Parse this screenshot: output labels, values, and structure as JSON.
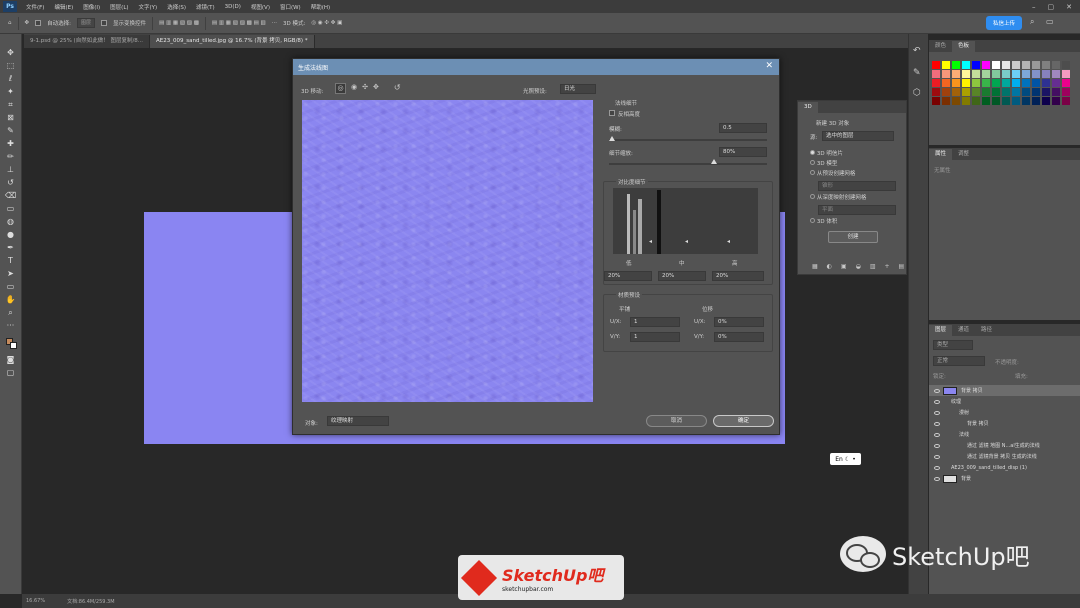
{
  "menu": {
    "items": [
      "文件(F)",
      "编辑(E)",
      "图像(I)",
      "图层(L)",
      "文字(Y)",
      "选择(S)",
      "滤镜(T)",
      "3D(D)",
      "视图(V)",
      "窗口(W)",
      "帮助(H)"
    ],
    "app_badge": "Ps"
  },
  "options": {
    "auto_select": "自动选择:",
    "auto_select_value": "图层",
    "show_transform": "显示变换控件",
    "mode_3d": "3D 模式:",
    "cloud_button": "私信上传"
  },
  "tabs": [
    {
      "label": "9-1.psd @ 25% (自然如此做！ 图层复制/8...",
      "active": false
    },
    {
      "label": "AE23_009_sand_tilled.jpg @ 16.7% (背景 拷贝, RGB/8) *",
      "active": true
    }
  ],
  "status": {
    "zoom": "16.67%",
    "doc": "文档:86.4M/259.3M"
  },
  "dialog": {
    "title": "生成法线图",
    "move_3d": "3D 移动:",
    "light_preset_label": "光照预设:",
    "light_preset_value": "日光",
    "fine_detail": {
      "title": "法线细节",
      "invert_height": "反相高度",
      "blur_label": "模糊:",
      "blur_value": "0.5",
      "detail_label": "细节缩放:",
      "detail_value": "80%"
    },
    "contrast": {
      "title": "对比度细节",
      "low": "低",
      "mid": "中",
      "high": "高",
      "low_val": "20%",
      "mid_val": "20%",
      "high_val": "20%"
    },
    "material": {
      "title": "材质预设",
      "tiling": "平铺",
      "offset": "位移",
      "ux": "U/X:",
      "vy": "V/Y:",
      "tile_u": "1",
      "tile_v": "1",
      "off_u": "0%",
      "off_v": "0%"
    },
    "object_label": "对象:",
    "object_value": "纹理映射",
    "cancel": "取消",
    "ok": "确定"
  },
  "panel3d": {
    "tab": "3D",
    "new_object": "新建 3D 对象",
    "source_label": "源:",
    "source_value": "选中的图层",
    "options": [
      "3D 明信片",
      "3D 模型",
      "从预设创建网格",
      "从深度映射创建网格",
      "3D 体积"
    ],
    "preset_hint": "锥形",
    "depth_hint": "平面",
    "create": "创建"
  },
  "swatches": {
    "tabs": [
      "颜色",
      "色板"
    ],
    "colors": [
      "#ff0000",
      "#ffff00",
      "#00ff00",
      "#00ffff",
      "#0000ff",
      "#ff00ff",
      "#ffffff",
      "#e6e6e6",
      "#cccccc",
      "#b3b3b3",
      "#999999",
      "#808080",
      "#666666",
      "#4d4d4d",
      "#f26d7d",
      "#f7977a",
      "#fbad76",
      "#fff79a",
      "#c4df9b",
      "#a3d39c",
      "#82ca9c",
      "#7accc8",
      "#6dcff6",
      "#7da7d9",
      "#8393ca",
      "#8781bd",
      "#a187be",
      "#f49ac1",
      "#ed1c24",
      "#f26522",
      "#f7941d",
      "#fff200",
      "#8dc63f",
      "#39b54a",
      "#00a651",
      "#00a99d",
      "#00aeef",
      "#0072bc",
      "#0054a6",
      "#2e3192",
      "#662d91",
      "#ec008c",
      "#9e0b0f",
      "#a0410d",
      "#a36209",
      "#aba000",
      "#598527",
      "#1a7b30",
      "#007236",
      "#00746b",
      "#0076a3",
      "#004b80",
      "#003471",
      "#1b1464",
      "#440e62",
      "#9e005d",
      "#790000",
      "#7b2e00",
      "#7d4900",
      "#827b00",
      "#406618",
      "#005e20",
      "#005826",
      "#005952",
      "#005b7f",
      "#003663",
      "#002157",
      "#0d004c",
      "#32004b",
      "#7b0046"
    ]
  },
  "properties": {
    "tabs": [
      "属性",
      "调整"
    ],
    "hint": "无属性"
  },
  "layers": {
    "tabs": [
      "图层",
      "通道",
      "路径"
    ],
    "kind": "类型",
    "mode": "正常",
    "opacity": "不透明度:",
    "lock": "锁定:",
    "fill": "填充:",
    "rows": [
      {
        "name": "背景 拷贝",
        "indent": 0,
        "selected": true
      },
      {
        "name": "纹理",
        "indent": 1,
        "selected": false
      },
      {
        "name": "漫射",
        "indent": 2,
        "selected": false
      },
      {
        "name": "背景 拷贝",
        "indent": 3,
        "selected": false
      },
      {
        "name": "法线",
        "indent": 2,
        "selected": false
      },
      {
        "name": "通过 滤镜 地图 N...al生成的法线",
        "indent": 3,
        "selected": false
      },
      {
        "name": "通过 滤镜背景 拷贝 生成的法线",
        "indent": 3,
        "selected": false
      },
      {
        "name": "AE23_009_sand_tilled_disp (1)",
        "indent": 1,
        "selected": false
      },
      {
        "name": "背景",
        "indent": 0,
        "selected": false
      }
    ]
  },
  "ime": {
    "label": "En"
  },
  "watermark": {
    "text": "SketchUp吧"
  },
  "logo": {
    "name": "SketchUp吧",
    "url": "sketchupbar.com"
  }
}
